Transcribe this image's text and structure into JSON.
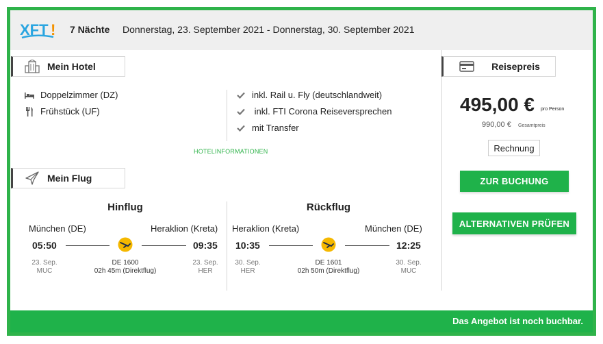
{
  "colors": {
    "accent_green": "#1fb24a",
    "border_green": "#2fb34a",
    "header_bg": "#efefef",
    "logo_blue": "#2aa5e0",
    "logo_orange": "#f39200",
    "airline_yellow": "#f5b800"
  },
  "header": {
    "logo_text": "XFT!",
    "nights": "7 Nächte",
    "dates": "Donnerstag, 23. September 2021 - Donnerstag, 30. September 2021"
  },
  "hotel": {
    "tab_label": "Mein Hotel",
    "tab_icon": "hotel-building-icon",
    "room": {
      "icon": "bed-icon",
      "text": "Doppelzimmer (DZ)"
    },
    "board": {
      "icon": "cutlery-icon",
      "text": "Frühstück (UF)"
    },
    "inclusions": [
      {
        "icon": "check-icon",
        "text": "inkl. Rail u. Fly (deutschlandweit)"
      },
      {
        "icon": "check-icon",
        "text": " inkl. FTI Corona Reiseversprechen"
      },
      {
        "icon": "check-icon",
        "text": "mit Transfer"
      }
    ],
    "info_link": "HOTELINFORMATIONEN"
  },
  "flight": {
    "tab_label": "Mein Flug",
    "tab_icon": "airplane-icon",
    "outbound": {
      "title": "Hinflug",
      "from_city": "München (DE)",
      "to_city": "Heraklion (Kreta)",
      "dep_time": "05:50",
      "arr_time": "09:35",
      "dep_date": "23. Sep.",
      "dep_code": "MUC",
      "arr_date": "23. Sep.",
      "arr_code": "HER",
      "flight_no": "DE 1600",
      "duration": "02h 45m (Direktflug)"
    },
    "return": {
      "title": "Rückflug",
      "from_city": "Heraklion (Kreta)",
      "to_city": "München (DE)",
      "dep_time": "10:35",
      "arr_time": "12:25",
      "dep_date": "30. Sep.",
      "dep_code": "HER",
      "arr_date": "30. Sep.",
      "arr_code": "MUC",
      "flight_no": "DE 1601",
      "duration": "02h 50m (Direktflug)"
    }
  },
  "price": {
    "tab_label": "Reisepreis",
    "tab_icon": "credit-card-icon",
    "per_person": "495,00 €",
    "per_person_label": "pro Person",
    "total": "990,00 €",
    "total_label": "Gesamtpreis",
    "invoice_label": "Rechnung",
    "booking_label": "ZUR BUCHUNG",
    "alternatives_label": "ALTERNATIVEN PRÜFEN"
  },
  "footer": {
    "status": "Das Angebot ist noch buchbar."
  }
}
